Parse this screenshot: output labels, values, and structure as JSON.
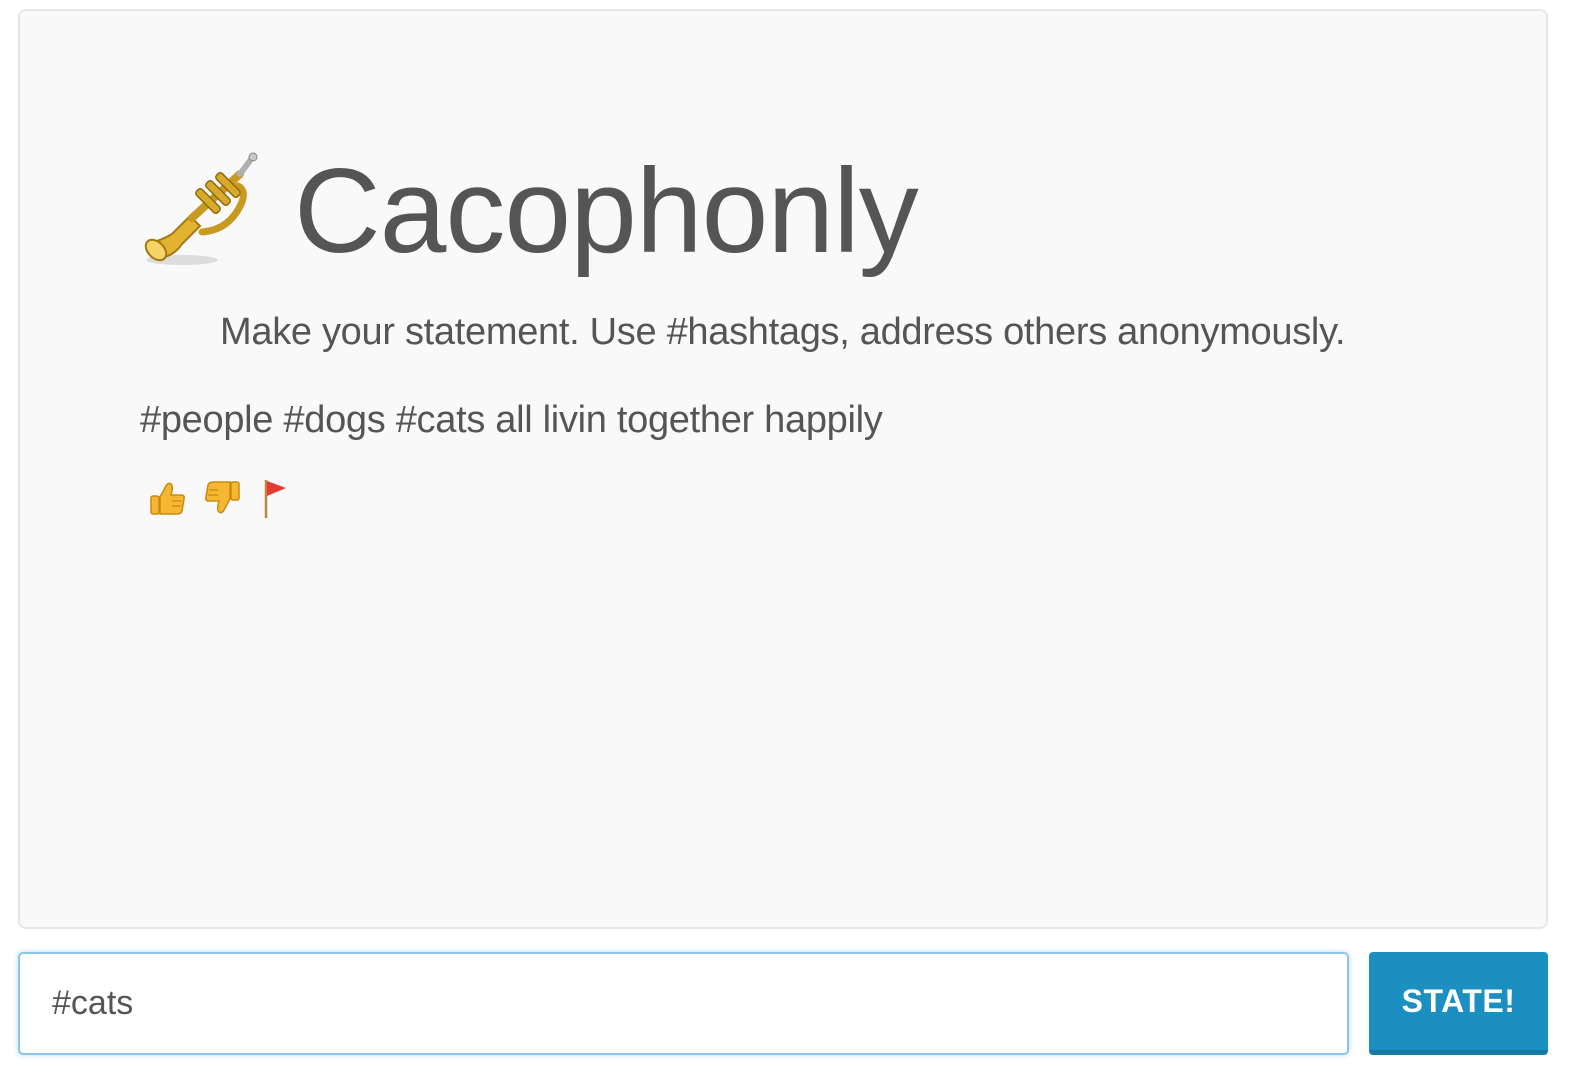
{
  "app": {
    "title": "Cacophonly",
    "logo_icon": "trumpet-icon",
    "tagline": "Make your statement. Use #hashtags, address others anonymously."
  },
  "post": {
    "text": "#people #dogs #cats all livin together happily",
    "actions": [
      {
        "name": "upvote",
        "icon": "thumbs-up-icon"
      },
      {
        "name": "downvote",
        "icon": "thumbs-down-icon"
      },
      {
        "name": "flag",
        "icon": "flag-icon"
      }
    ]
  },
  "composer": {
    "value": "#cats",
    "submit_label": "STATE!"
  },
  "colors": {
    "panel_background": "#f9f9f9",
    "button_accent": "#1b8fc0",
    "input_focus_border": "#8cc4ea",
    "text": "#555555",
    "flag_red": "#e53935",
    "emoji_yellow": "#f6b733"
  }
}
